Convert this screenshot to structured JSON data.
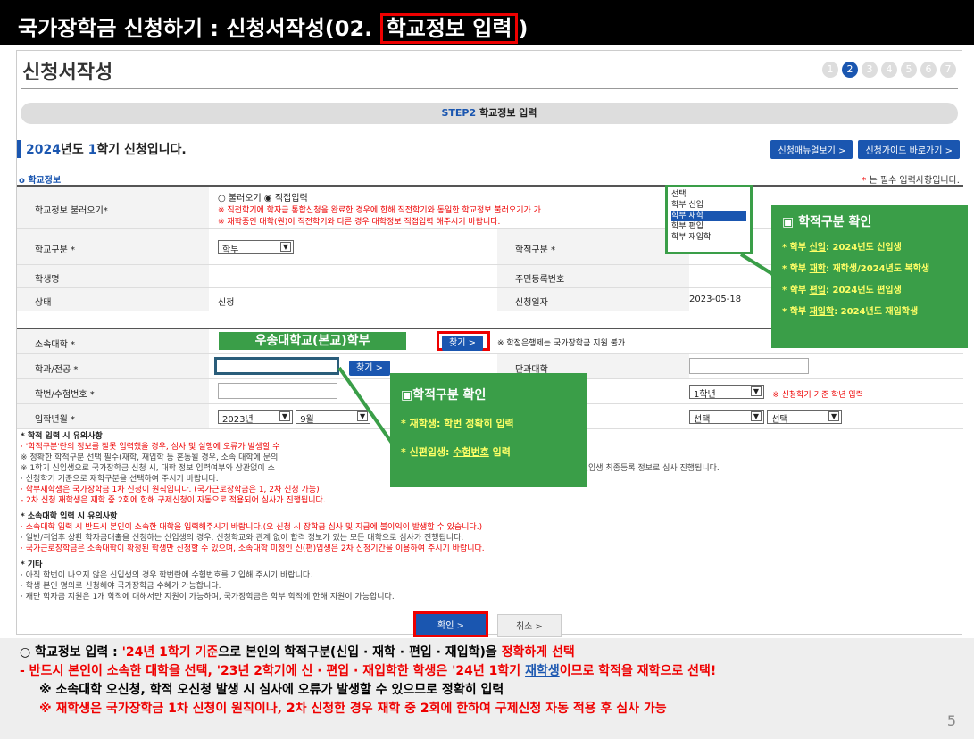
{
  "banner": {
    "prefix": "국가장학금 신청하기 : 신청서작성(02. ",
    "highlight": "학교정보 입력",
    "suffix": ")"
  },
  "page_title": "신청서작성",
  "steps": [
    "1",
    "2",
    "3",
    "4",
    "5",
    "6",
    "7"
  ],
  "step_bar": {
    "step": "STEP2",
    "label": "학교정보 입력"
  },
  "semester": {
    "year": "2024",
    "mid": "년도 ",
    "sem": "1",
    "rest": "학기 신청입니다."
  },
  "buttons": {
    "manual": "신청매뉴얼보기 >",
    "guide": "신청가이드 바로가기 >",
    "find": "찾기 >",
    "find2": "찾기 >",
    "ok": "확인  >",
    "cancel": "취소  >"
  },
  "section_title": "학교정보",
  "required_note": "는 필수 입력사항입니다.",
  "form": {
    "load_label": "학교정보 불러오기",
    "load_opt1": "불러오기",
    "load_opt2": "직접입력",
    "load_note1": "※ 직전학기에 학자금 통합신청을 완료한 경우에 한해 직전학기와 동일한 학교정보 불러오기가 가",
    "load_note2": "※ 재학중인 대학(원)이 직전학기와 다른 경우 대학정보 직접입력 해주시기 바랍니다.",
    "school_type_label": "학교구분",
    "school_type_value": "학부",
    "academic_label": "학적구분",
    "name_label": "학생명",
    "rrn_label": "주민등록번호",
    "status_label": "상태",
    "status_value": "신청",
    "date_label": "신청일자",
    "date_value": "2023-05-18",
    "univ_label": "소속대학",
    "univ_value": "우송대학교(본교)학부",
    "univ_note": "※ 학점은행제는 국가장학금 지원 불가",
    "major_label": "학과/전공",
    "college_label": "단과대학",
    "id_label": "학번/수험번호",
    "grade_value": "1학년",
    "grade_note": "※ 신청학기 기준 학년 입력",
    "entry_label": "입학년월",
    "entry_year": "2023년",
    "entry_month": "9월",
    "select1": "선택",
    "select2": "선택"
  },
  "dropdown_options": [
    "선택",
    "학부 신입",
    "학부 재학",
    "학부 편입",
    "학부 재입학"
  ],
  "callout1": {
    "title": "▣ 학적구분 확인",
    "items": [
      {
        "k": "* 학부 ",
        "u": "신입",
        "v": ": 2024년도 신입생"
      },
      {
        "k": "* 학부 ",
        "u": "재학",
        "v": ": 재학생/2024년도 복학생"
      },
      {
        "k": "* 학부 ",
        "u": "편입",
        "v": ": 2024년도 편입생"
      },
      {
        "k": "* 학부 ",
        "u": "재입학",
        "v": ": 2024년도 재입학생"
      }
    ]
  },
  "callout2": {
    "title": "▣학적구분 확인",
    "line1_pre": "* 재학생: ",
    "line1_u": "학번",
    "line1_post": " 정확히 입력",
    "line2_pre": "* 신편입생: ",
    "line2_u": "수험번호",
    "line2_post": " 입력"
  },
  "notes": {
    "h1": "* 학적 입력 시 유의사항",
    "n1": "· '학적구분'란의 정보를 잘못 입력했을 경우, 심사 및 실행에 오류가 발생할 수",
    "n2": "  ※ 정확한 학적구분 선택 필수(재학, 재입학 등 혼동될 경우, 소속 대학에 문의",
    "n3": "  ※ 1학기 신입생으로 국가장학금 신청 시, 대학 정보 입력여부와 상관없이 소",
    "n3b": "공하는 신입생 최종등록 정보로 심사 진행됩니다.",
    "n4": "· 신청학기 기준으로 재학구분을 선택하여 주시기 바랍니다.",
    "n5": "· 학부재학생은 국가장학금 1차 신청이 원칙입니다. (국가근로장학금은 1, 2차 신청 가능)",
    "n6": "  - 2차 신청 재학생은 재학 중 2회에 한해 구제신청이 자동으로 적용되어 심사가 진행됩니다.",
    "h2": "* 소속대학 입력 시 유의사항",
    "m1": "· 소속대학 입력 시 반드시 본인이 소속한 대학을 입력해주시기 바랍니다.(오 신청 시 장학금 심사 및 지급에 불이익이 발생할 수 있습니다.)",
    "m2": "· 일반/취업후 상환 학자금대출을 신청하는 신입생의 경우, 신청학교와 관계 없이 합격 정보가 있는 모든 대학으로 심사가 진행됩니다.",
    "m3": "· 국가근로장학금은 소속대학이 확정된 학생만 신청할 수 있으며, 소속대학 미정인 신(편)입생은 2차 신청기간을 이용하여 주시기 바랍니다.",
    "h3": "* 기타",
    "e1": "· 아직 학번이 나오지 않은 신입생의 경우 학번란에 수험번호를 기입해 주시기 바랍니다.",
    "e2": "· 학생 본인 명의로 신청해야 국가장학금 수혜가 가능합니다.",
    "e3": "· 재단 학자금 지원은 1개 학적에 대해서만 지원이 가능하며, 국가장학금은 학부 학적에 한해 지원이 가능합니다."
  },
  "footer": {
    "l1a": "○ 학교정보 입력 : ",
    "l1b": "'24년 1학기 기준",
    "l1c": "으로 본인의 학적구분(신입 · 재학 · 편입 · 재입학)을 ",
    "l1d": "정확하게 선택",
    "l2a": "- 반드시 본인이 소속한 대학을 선택, '23년 2학기에 신 · 편입 · 재입학한 학생은 '24년 1학기 ",
    "l2b": "재학생",
    "l2c": "이므로 학적을 재학으로 선택!",
    "l3": "※ 소속대학 오신청, 학적 오신청 발생 시 심사에 오류가 발생할 수 있으므로 정확히 입력",
    "l4": "※ 재학생은 국가장학금 1차 신청이 원칙이나, 2차 신청한 경우 재학 중 2회에 한하여 구제신청 자동 적용 후 심사 가능",
    "page": "5"
  }
}
